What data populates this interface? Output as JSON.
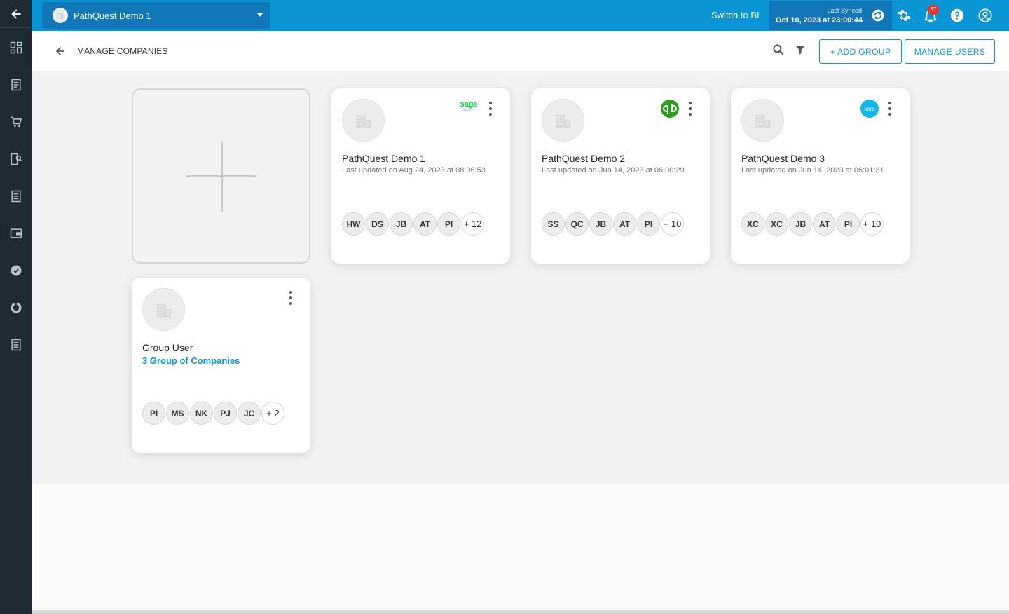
{
  "topbar": {
    "company_name": "PathQuest Demo 1",
    "switch_label": "Switch to BI",
    "sync_label": "Last Synced",
    "sync_date": "Oct 10, 2023 at 23:00:44",
    "notification_count": "67"
  },
  "subheader": {
    "title": "MANAGE COMPANIES",
    "add_group_label": "+ ADD GROUP",
    "manage_users_label": "MANAGE USERS"
  },
  "companies": [
    {
      "name": "PathQuest Demo 1",
      "updated": "Last updated on Aug 24, 2023 at 08:06:53",
      "integration": "sage-intacct",
      "integration_text": "sage",
      "integration_subtext": "Intacct",
      "users": [
        "HW",
        "DS",
        "JB",
        "AT",
        "PI"
      ],
      "more": "+ 12"
    },
    {
      "name": "PathQuest Demo 2",
      "updated": "Last updated on Jun 14, 2023 at 06:00:29",
      "integration": "quickbooks",
      "users": [
        "SS",
        "QC",
        "JB",
        "AT",
        "PI"
      ],
      "more": "+ 10"
    },
    {
      "name": "PathQuest Demo 3",
      "updated": "Last updated on Jun 14, 2023 at 06:01:31",
      "integration": "xero",
      "integration_text": "xero",
      "users": [
        "XC",
        "XC",
        "JB",
        "AT",
        "PI"
      ],
      "more": "+ 10"
    }
  ],
  "group": {
    "name": "Group User",
    "link": "3 Group of Companies",
    "users": [
      "PI",
      "MS",
      "NK",
      "PJ",
      "JC"
    ],
    "more": "+ 2"
  },
  "colors": {
    "primary": "#0a96d4",
    "topbar_dark": "#1277b8",
    "sidebar": "#1f2b33",
    "sage": "#00d639",
    "quickbooks": "#2ca01c",
    "xero": "#13b5ea"
  },
  "sidebar_icons": [
    "back-arrow-icon",
    "dashboard-icon",
    "report-icon",
    "cart-icon",
    "pdf-search-icon",
    "document-icon",
    "wallet-icon",
    "verified-icon",
    "pie-chart-icon",
    "list-icon"
  ]
}
